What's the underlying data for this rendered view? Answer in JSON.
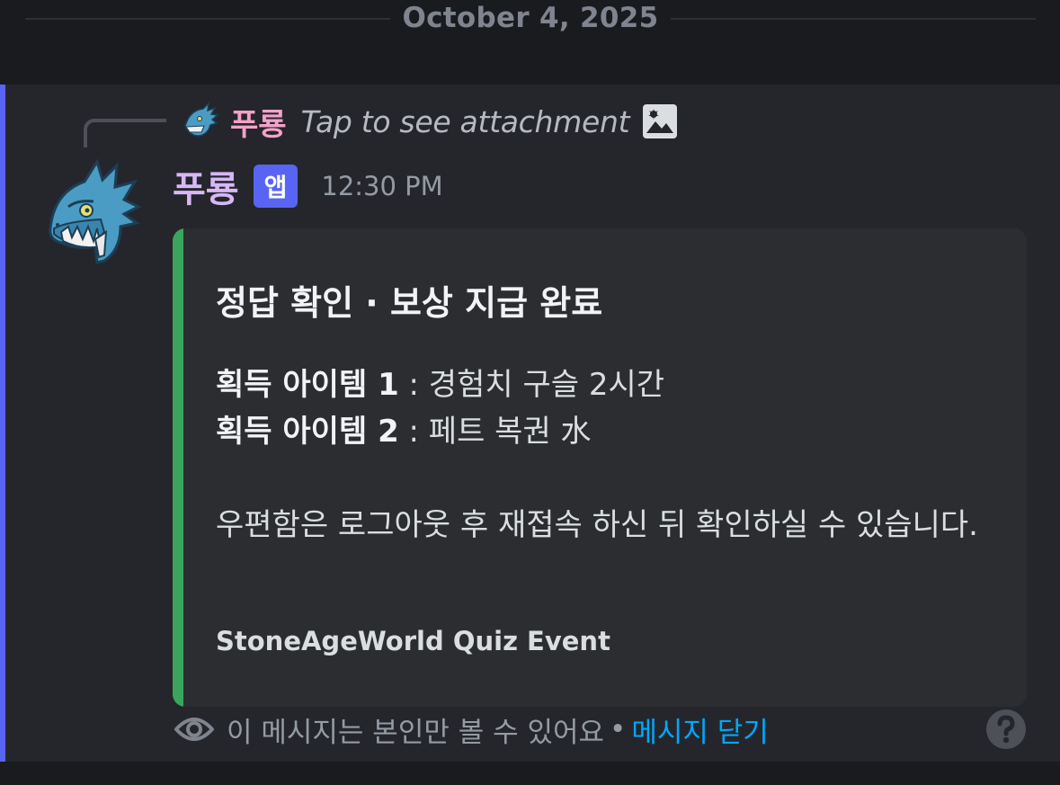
{
  "date_divider": {
    "text": "October 4, 2025"
  },
  "reply": {
    "author": "푸룡",
    "text": "Tap to see attachment",
    "icon": "image-icon"
  },
  "message": {
    "author": "푸룡",
    "badge": "앱",
    "timestamp": "12:30 PM",
    "author_color": "#d7b8f5"
  },
  "embed": {
    "accent_color": "#3ba55d",
    "title": "정답 확인 · 보상 지급 완료",
    "fields": [
      {
        "label": "획득 아이템 1",
        "value": " : 경험치 구슬 2시간"
      },
      {
        "label": "획득 아이템 2",
        "value": " : 페트 복권 水"
      }
    ],
    "description": "우편함은 로그아웃 후 재접속 하신 뒤 확인하실 수 있습니다.",
    "footer": "StoneAgeWorld Quiz Event"
  },
  "ephemeral": {
    "notice": "이 메시지는 본인만 볼 수 있어요",
    "separator": "•",
    "dismiss_label": "메시지 닫기"
  },
  "colors": {
    "background": "#1a1b1f",
    "message_bg": "#25262c",
    "highlight": "#5865f2",
    "link": "#00a8fc"
  }
}
